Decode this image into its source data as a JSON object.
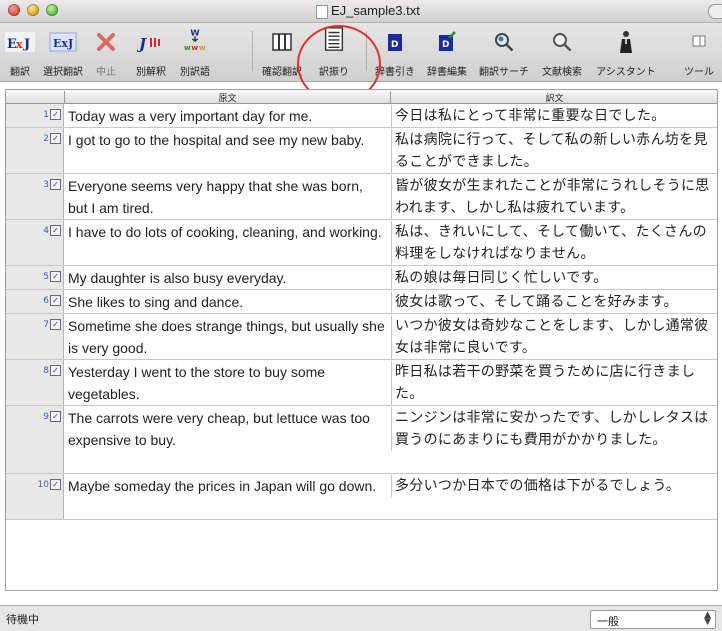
{
  "window": {
    "title": "EJ_sample3.txt"
  },
  "toolbar": {
    "buttons": [
      {
        "label": "翻訳",
        "icon": "translate-icon",
        "text": "ExJ"
      },
      {
        "label": "選択翻訳",
        "icon": "selection-translate-icon",
        "text": "ExJ"
      },
      {
        "label": "中止",
        "icon": "stop-icon",
        "text": "✕"
      },
      {
        "label": "別解釈",
        "icon": "alternate-interpretation-icon",
        "text": "J"
      },
      {
        "label": "別訳語",
        "icon": "alternate-word-icon",
        "text": "W"
      },
      {
        "label": "確認翻訳",
        "icon": "confirm-translate-icon",
        "text": "Ⅲ"
      },
      {
        "label": "訳振り",
        "icon": "interlinear-icon",
        "text": "≡"
      },
      {
        "label": "辞書引き",
        "icon": "dictionary-lookup-icon",
        "text": "D"
      },
      {
        "label": "辞書編集",
        "icon": "dictionary-edit-icon",
        "text": "D"
      },
      {
        "label": "翻訳サーチ",
        "icon": "translation-search-icon",
        "text": "⌕"
      },
      {
        "label": "文献検索",
        "icon": "literature-search-icon",
        "text": "⌕"
      },
      {
        "label": "アシスタント",
        "icon": "assistant-icon",
        "text": "♟"
      },
      {
        "label": "ツール",
        "icon": "tools-icon",
        "text": "▭"
      }
    ]
  },
  "table": {
    "headers": {
      "source": "原文",
      "target": "訳文"
    },
    "rows": [
      {
        "n": "1",
        "src": "Today was a very important day for me.",
        "tgt": "今日は私にとって非常に重要な日でした。"
      },
      {
        "n": "2",
        "src": "I got to go to the hospital and see my new baby.",
        "tgt": "私は病院に行って、そして私の新しい赤ん坊を見ることができました。"
      },
      {
        "n": "3",
        "src": "Everyone seems very happy that she was born, but I am tired.",
        "tgt": "皆が彼女が生まれたことが非常にうれしそうに思われます、しかし私は疲れています。"
      },
      {
        "n": "4",
        "src": "I have to do lots of cooking, cleaning, and working.",
        "tgt": "私は、きれいにして、そして働いて、たくさんの料理をしなければなりません。"
      },
      {
        "n": "5",
        "src": "My daughter is also busy everyday.",
        "tgt": "私の娘は毎日同じく忙しいです。"
      },
      {
        "n": "6",
        "src": "She likes to sing and dance.",
        "tgt": "彼女は歌って、そして踊ることを好みます。"
      },
      {
        "n": "7",
        "src": "Sometime she does strange things, but usually she is very good.",
        "tgt": "いつか彼女は奇妙なことをします、しかし通常彼女は非常に良いです。"
      },
      {
        "n": "8",
        "src": "Yesterday I went to the store to buy some vegetables.",
        "tgt": "昨日私は若干の野菜を買うために店に行きました。"
      },
      {
        "n": "9",
        "src": "The carrots were very cheap, but lettuce was too expensive to buy.",
        "tgt": "ニンジンは非常に安かったです、しかしレタスは買うのにあまりにも費用がかかりました。"
      },
      {
        "n": "10",
        "src": "Maybe someday the prices in Japan will go down.",
        "tgt": "多分いつか日本での価格は下がるでしょう。"
      }
    ]
  },
  "status": {
    "text": "待機中",
    "select_value": "一般"
  },
  "colors": {
    "highlight_circle": "#d9352a",
    "row_number": "#3b5cc4"
  }
}
